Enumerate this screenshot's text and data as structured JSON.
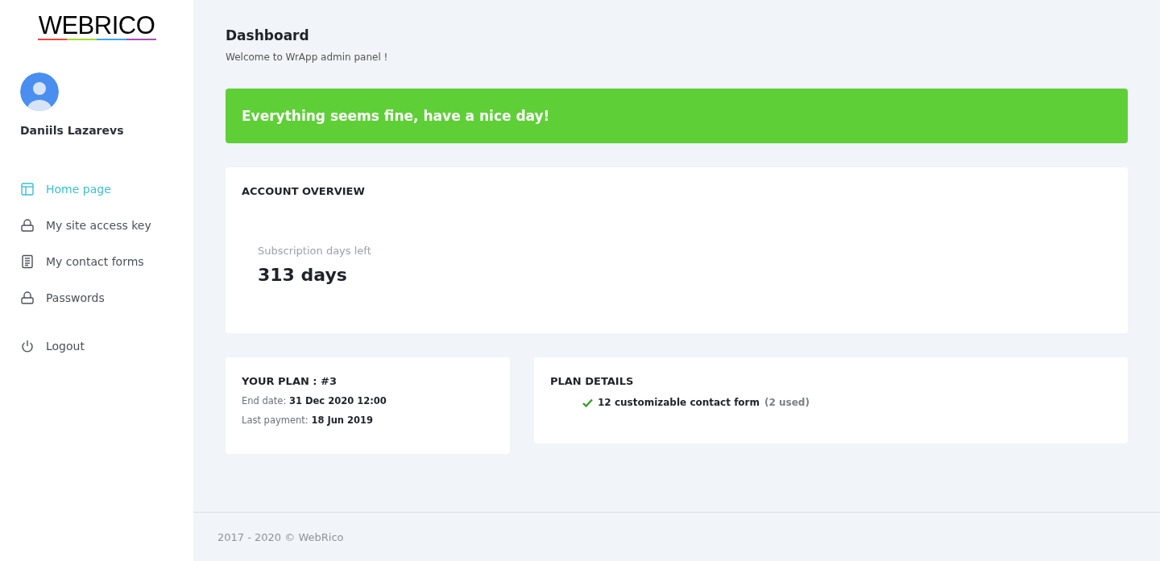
{
  "sidebar": {
    "logo": "WEBRICO",
    "user": {
      "name": "Daniils Lazarevs"
    },
    "nav": [
      {
        "label": "Home page",
        "kind": "layout",
        "selected": true
      },
      {
        "label": "My site access key",
        "kind": "lock",
        "selected": false
      },
      {
        "label": "My contact forms",
        "kind": "document",
        "selected": false
      },
      {
        "label": "Passwords",
        "kind": "lock",
        "selected": false
      }
    ],
    "logout": {
      "label": "Logout",
      "kind": "power",
      "selected": false
    }
  },
  "header": {
    "title": "Dashboard",
    "subtitle": "Welcome to WrApp admin panel !"
  },
  "alert": {
    "text": "Everything seems fine, have a nice day!"
  },
  "account_overview": {
    "title": "ACCOUNT OVERVIEW",
    "stat_label": "Subscription days left",
    "stat_value": "313 days"
  },
  "plan": {
    "title": "YOUR PLAN : #3",
    "fields": [
      {
        "label": "End date:",
        "value": "31 Dec 2020 12:00"
      },
      {
        "label": "Last payment:",
        "value": "18 Jun 2019"
      }
    ]
  },
  "plan_details": {
    "title": "PLAN DETAILS",
    "items": [
      {
        "text": "12 customizable contact form",
        "note": "(2 used)"
      }
    ]
  },
  "footer": {
    "text": "2017 - 2020 © WebRico"
  }
}
